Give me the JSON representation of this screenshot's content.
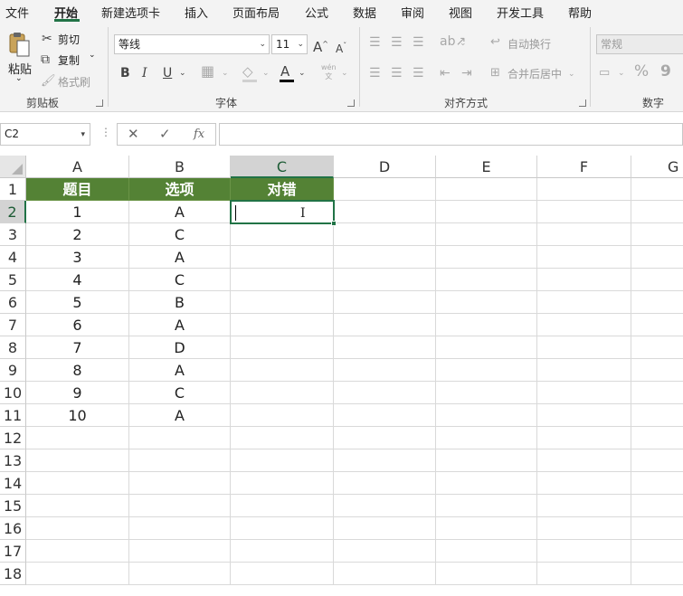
{
  "ribbon_tabs": [
    "文件",
    "开始",
    "新建选项卡",
    "插入",
    "页面布局",
    "公式",
    "数据",
    "审阅",
    "视图",
    "开发工具",
    "帮助"
  ],
  "active_tab": "开始",
  "clipboard": {
    "paste": "粘贴",
    "cut": "剪切",
    "copy": "复制",
    "format_painter": "格式刷",
    "label": "剪贴板"
  },
  "font": {
    "name": "等线",
    "size": "11",
    "grow": "A",
    "shrink": "A",
    "bold": "B",
    "italic": "I",
    "underline": "U",
    "font_color": "A",
    "phonetic": "wén",
    "label": "字体"
  },
  "alignment": {
    "wrap_text": "自动换行",
    "merge_center": "合并后居中",
    "label": "对齐方式"
  },
  "number": {
    "format": "常规",
    "percent": "%",
    "comma": "9",
    "label": "数字"
  },
  "formula_bar": {
    "name_box": "C2",
    "cancel": "✕",
    "enter": "✓",
    "fx": "fx",
    "value": ""
  },
  "sheet": {
    "columns": [
      "A",
      "B",
      "C",
      "D",
      "E",
      "F",
      "G"
    ],
    "rows": [
      "1",
      "2",
      "3",
      "4",
      "5",
      "6",
      "7",
      "8",
      "9",
      "10",
      "11",
      "12",
      "13",
      "14",
      "15",
      "16",
      "17",
      "18"
    ],
    "header": [
      "题目",
      "选项",
      "对错"
    ],
    "data": [
      [
        "1",
        "A",
        ""
      ],
      [
        "2",
        "C",
        ""
      ],
      [
        "3",
        "A",
        ""
      ],
      [
        "4",
        "C",
        ""
      ],
      [
        "5",
        "B",
        ""
      ],
      [
        "6",
        "A",
        ""
      ],
      [
        "7",
        "D",
        ""
      ],
      [
        "8",
        "A",
        ""
      ],
      [
        "9",
        "C",
        ""
      ],
      [
        "10",
        "A",
        ""
      ]
    ],
    "header_color": "#548235",
    "accent": "#217346",
    "selected_cell": "C2"
  }
}
